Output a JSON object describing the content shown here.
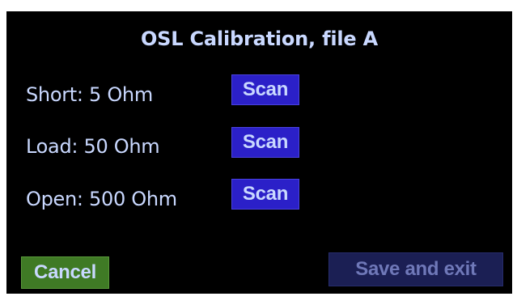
{
  "screen": {
    "title": "OSL Calibration, file A"
  },
  "rows": [
    {
      "label": "Short: 5 Ohm",
      "button_label": "Scan"
    },
    {
      "label": "Load: 50 Ohm",
      "button_label": "Scan"
    },
    {
      "label": "Open: 500 Ohm",
      "button_label": "Scan"
    }
  ],
  "footer": {
    "cancel_label": "Cancel",
    "save_label": "Save and exit"
  },
  "colors": {
    "background": "#000000",
    "text": "#c9d8ff",
    "scan_button": "#2b20c8",
    "cancel_button": "#3f7a25",
    "save_button_disabled": "#1b1f54",
    "save_text_disabled": "#6f78b8"
  }
}
